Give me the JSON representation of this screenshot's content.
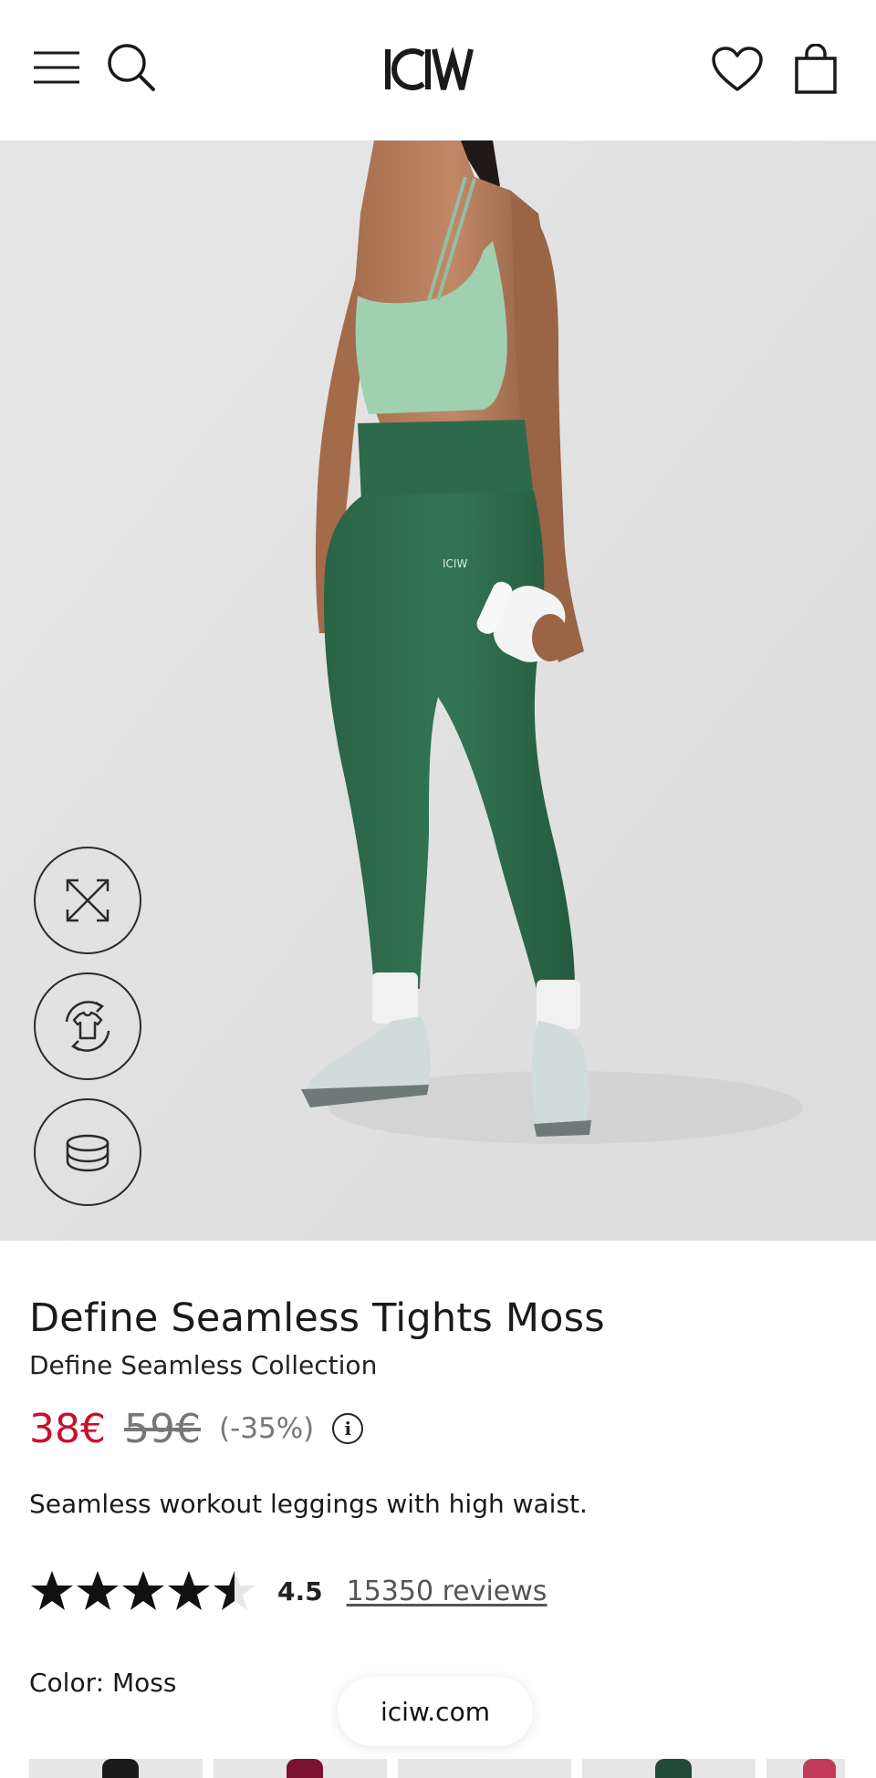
{
  "header": {
    "menu_icon": "hamburger-menu-icon",
    "search_icon": "search-icon",
    "logo_text": "ICIW",
    "wishlist_icon": "heart-icon",
    "bag_icon": "shopping-bag-icon"
  },
  "hero": {
    "image_description_icon": "product-photo",
    "leggings_logo": "ICIW",
    "tools": [
      {
        "icon": "expand-arrows-icon"
      },
      {
        "icon": "tshirt-rotate-icon"
      },
      {
        "icon": "fabric-layers-icon"
      }
    ]
  },
  "product": {
    "title": "Define Seamless Tights Moss",
    "collection": "Define Seamless Collection",
    "price_sale": "38€",
    "price_original": "59€",
    "discount": "(-35%)",
    "price_info_glyph": "i",
    "description": "Seamless workout leggings with high waist.",
    "rating_value": "4.5",
    "rating_fraction": 0.9,
    "reviews_link": "15350 reviews",
    "color_label": "Color: Moss"
  },
  "footer_pill": {
    "domain": "iciw.com"
  },
  "colors": {
    "sale_price": "#c8102e",
    "leggings": "#2f6b4a",
    "bra": "#9fd0b0",
    "hero_bg": "#e3e3e3"
  }
}
